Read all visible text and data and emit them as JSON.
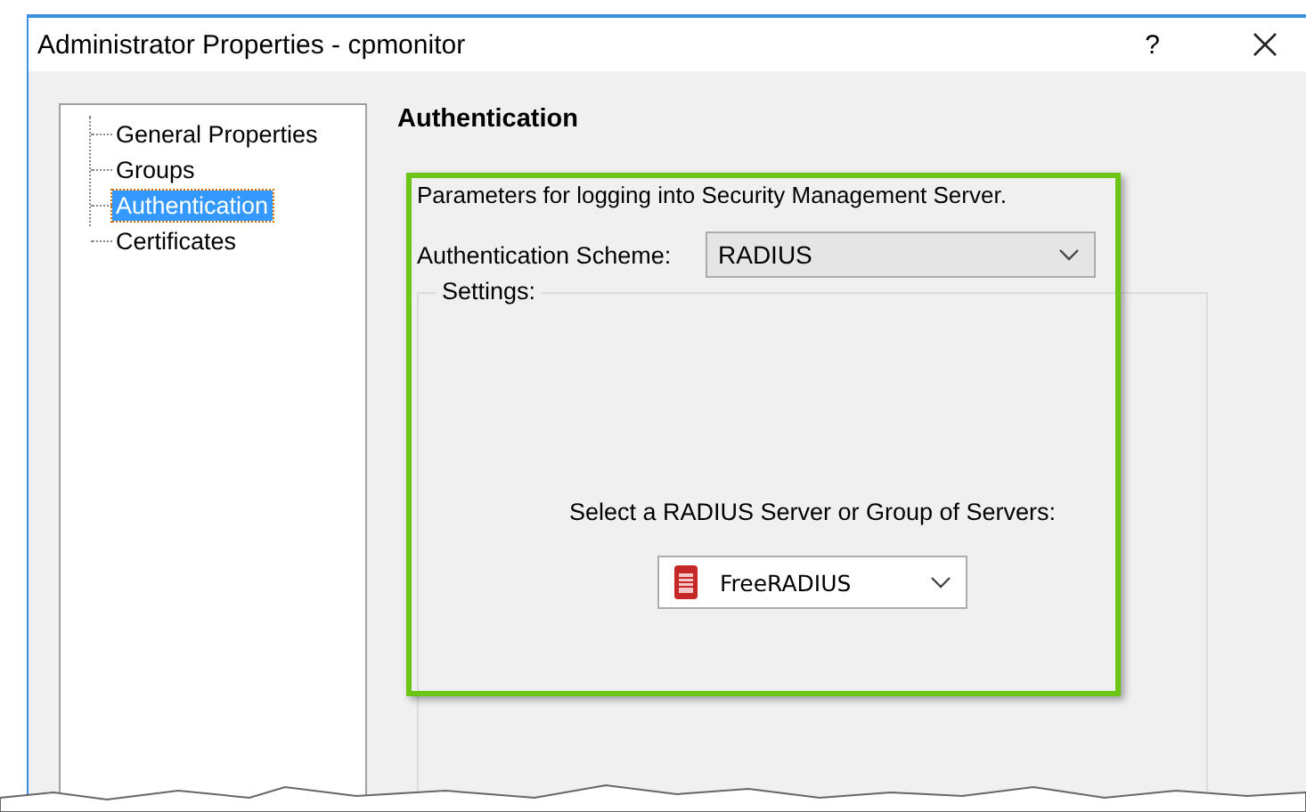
{
  "window": {
    "title": "Administrator Properties - cpmonitor",
    "help": "?"
  },
  "tree": {
    "items": [
      {
        "label": "General Properties",
        "selected": false
      },
      {
        "label": "Groups",
        "selected": false
      },
      {
        "label": "Authentication",
        "selected": true
      },
      {
        "label": "Certificates",
        "selected": false
      }
    ]
  },
  "page": {
    "heading": "Authentication",
    "description": "Parameters for logging into Security Management Server.",
    "scheme": {
      "label": "Authentication Scheme:",
      "value": "RADIUS"
    },
    "settings": {
      "legend": "Settings:",
      "prompt": "Select a RADIUS Server or Group of Servers:",
      "server": {
        "value": "FreeRADIUS"
      }
    }
  }
}
